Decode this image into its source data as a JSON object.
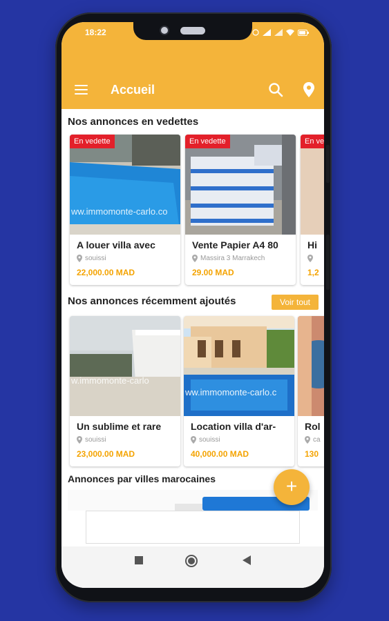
{
  "status_bar": {
    "time": "18:22"
  },
  "appbar": {
    "title": "Accueil",
    "menu_icon": "hamburger-menu-icon",
    "search_icon": "search-icon",
    "location_icon": "map-pin-icon"
  },
  "colors": {
    "primary": "#f4b43a",
    "badge": "#e3202a",
    "price": "#f4a300",
    "background": "#2535a3"
  },
  "featured": {
    "heading": "Nos annonces en vedettes",
    "items": [
      {
        "badge": "En vedette",
        "title": "A louer villa avec",
        "location": "souissi",
        "price": "22,000.00 MAD",
        "watermark": "ww.immomonte-carlo.co"
      },
      {
        "badge": "En vedette",
        "title": "Vente Papier A4 80",
        "location": "Massira 3 Marrakech",
        "price": "29.00 MAD"
      },
      {
        "badge": "En ve",
        "title": "Hi",
        "location": "",
        "price": "1,2"
      }
    ]
  },
  "recent": {
    "heading": "Nos annonces récemment ajoutés",
    "see_all": "Voir tout",
    "items": [
      {
        "title": "Un sublime et rare",
        "location": "souissi",
        "price": "23,000.00 MAD",
        "watermark": "w.immomonte-carlo"
      },
      {
        "title": "Location villa d'ar-",
        "location": "souissi",
        "price": "40,000.00 MAD",
        "watermark": "ww.immomonte-carlo.c"
      },
      {
        "title": "Rol",
        "location": "ca",
        "price": "130"
      }
    ]
  },
  "cities": {
    "heading": "Annonces par villes marocaines"
  },
  "fab": {
    "label": "+"
  }
}
